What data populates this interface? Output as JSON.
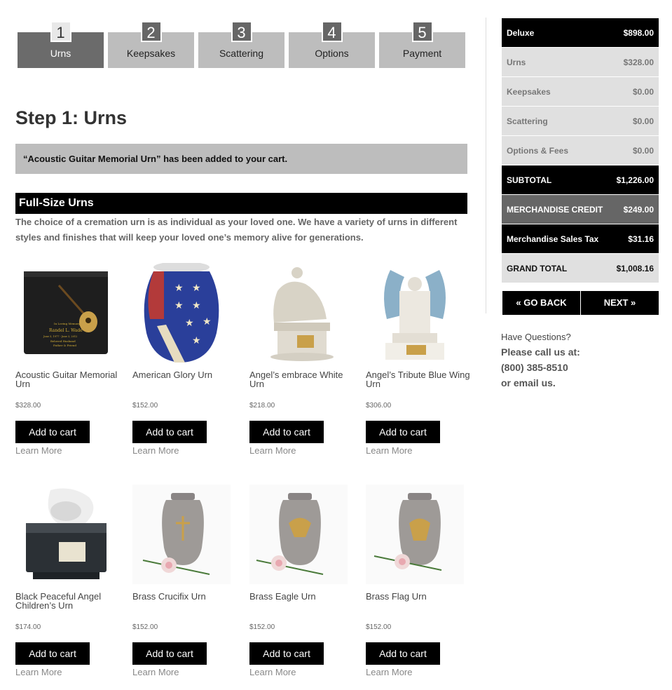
{
  "steps": [
    {
      "num": "1",
      "label": "Urns"
    },
    {
      "num": "2",
      "label": "Keepsakes"
    },
    {
      "num": "3",
      "label": "Scattering"
    },
    {
      "num": "4",
      "label": "Options"
    },
    {
      "num": "5",
      "label": "Payment"
    }
  ],
  "page_title": "Step 1: Urns",
  "notice": "“Acoustic Guitar Memorial Urn” has been added to your cart.",
  "section": {
    "title": "Full-Size Urns",
    "intro": "The choice of a cremation urn is as individual as your loved one.  We have a variety of urns in different styles and finishes that will keep your loved one’s memory alive for generations."
  },
  "products": [
    {
      "name": "Acoustic Guitar Memorial Urn",
      "price": "$328.00",
      "button": "Add to cart",
      "learn": "Learn More",
      "img_text": [
        "In Loving Memory",
        "Randel L. Wade",
        "June 5, 1977 - June 3, 2012",
        "Beloved Husband",
        "Father & Friend"
      ]
    },
    {
      "name": "American Glory Urn",
      "price": "$152.00",
      "button": "Add to cart",
      "learn": "Learn More"
    },
    {
      "name": "Angel’s embrace White Urn",
      "price": "$218.00",
      "button": "Add to cart",
      "learn": "Learn More"
    },
    {
      "name": "Angel’s Tribute Blue Wing Urn",
      "price": "$306.00",
      "button": "Add to cart",
      "learn": "Learn More"
    },
    {
      "name": "Black Peaceful Angel Children’s Urn",
      "price": "$174.00",
      "button": "Add to cart",
      "learn": "Learn More"
    },
    {
      "name": "Brass Crucifix Urn",
      "price": "$152.00",
      "button": "Add to cart",
      "learn": "Learn More"
    },
    {
      "name": "Brass Eagle Urn",
      "price": "$152.00",
      "button": "Add to cart",
      "learn": "Learn More"
    },
    {
      "name": "Brass Flag Urn",
      "price": "$152.00",
      "button": "Add to cart",
      "learn": "Learn More"
    }
  ],
  "summary": [
    {
      "label": "Deluxe",
      "value": "$898.00"
    },
    {
      "label": "Urns",
      "value": "$328.00"
    },
    {
      "label": "Keepsakes",
      "value": "$0.00"
    },
    {
      "label": "Scattering",
      "value": "$0.00"
    },
    {
      "label": "Options & Fees",
      "value": "$0.00"
    },
    {
      "label": "SUBTOTAL",
      "value": "$1,226.00"
    },
    {
      "label": "MERCHANDISE CREDIT",
      "value": "$249.00"
    },
    {
      "label": "Merchandise Sales Tax",
      "value": "$31.16"
    },
    {
      "label": "GRAND TOTAL",
      "value": "$1,008.16"
    }
  ],
  "nav": {
    "back": "« GO BACK",
    "next": "NEXT »"
  },
  "questions": {
    "title": "Have Questions?",
    "line1": "Please call us at:",
    "phone": "(800) 385-8510",
    "email": "or email us."
  }
}
